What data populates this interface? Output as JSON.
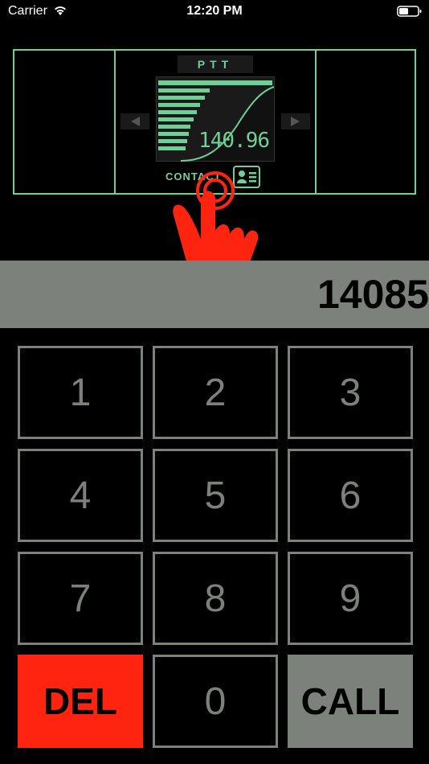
{
  "status_bar": {
    "carrier": "Carrier",
    "time": "12:20 PM",
    "wifi_icon": "wifi-icon",
    "battery_icon": "battery-icon"
  },
  "radio": {
    "ptt_label": "PTT",
    "frequency": "140.96",
    "contact_label": "CONTACT",
    "accent_color": "#6fcf97"
  },
  "display": {
    "value": "14085"
  },
  "keypad": {
    "keys": [
      "1",
      "2",
      "3",
      "4",
      "5",
      "6",
      "7",
      "8",
      "9"
    ],
    "del_label": "DEL",
    "zero_label": "0",
    "call_label": "CALL",
    "del_color": "#ff2410",
    "call_color": "#7d817c"
  }
}
